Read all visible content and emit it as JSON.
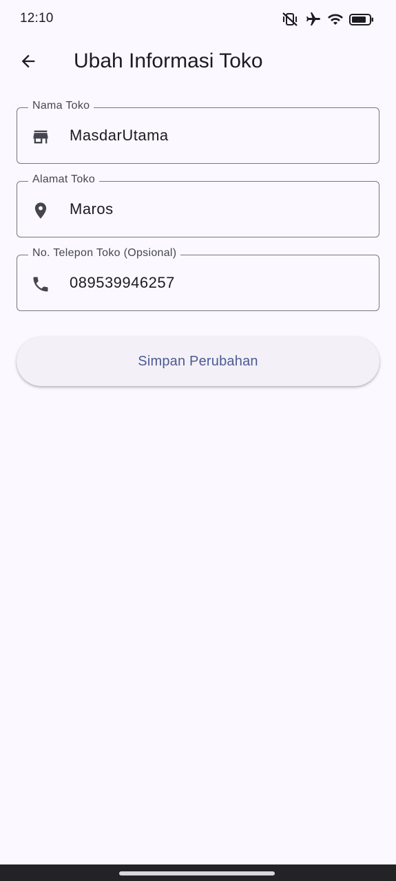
{
  "status_bar": {
    "time": "12:10",
    "icons": [
      "vibrate-off-icon",
      "airplane-icon",
      "wifi-icon",
      "battery-icon"
    ]
  },
  "app_bar": {
    "back_icon": "arrow-left-icon",
    "title": "Ubah Informasi Toko"
  },
  "form": {
    "fields": [
      {
        "label": "Nama Toko",
        "value": "MasdarUtama",
        "icon": "store-icon"
      },
      {
        "label": "Alamat Toko",
        "value": "Maros",
        "icon": "location-pin-icon"
      },
      {
        "label": "No. Telepon Toko (Opsional)",
        "value": "089539946257",
        "icon": "phone-icon"
      }
    ],
    "save_label": "Simpan Perubahan"
  },
  "colors": {
    "background": "#fbf8ff",
    "outline": "#77767d",
    "button_text": "#4a5a92",
    "button_bg": "#f4f0f8",
    "icon": "#45464f"
  }
}
